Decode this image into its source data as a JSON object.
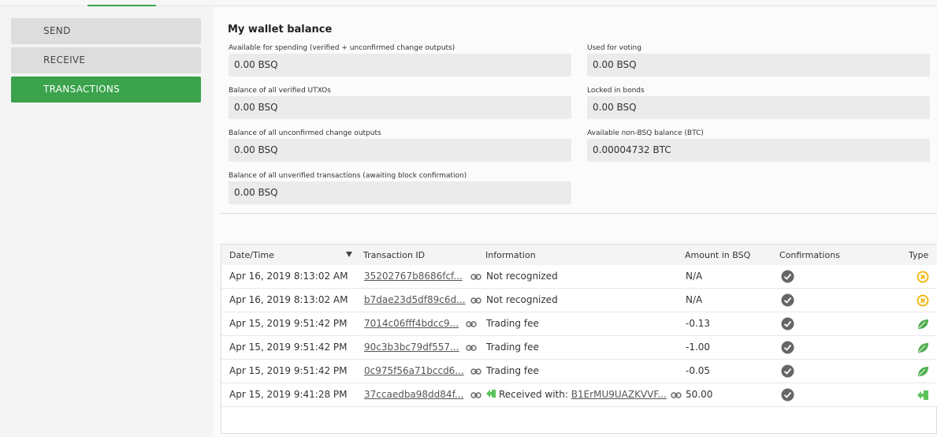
{
  "nav": {
    "send_label": "SEND",
    "receive_label": "RECEIVE",
    "transactions_label": "TRANSACTIONS"
  },
  "balance": {
    "title": "My wallet balance",
    "available_label": "Available for spending (verified + unconfirmed change outputs)",
    "available_value": "0.00 BSQ",
    "verified_label": "Balance of all verified UTXOs",
    "verified_value": "0.00 BSQ",
    "unconfirmed_change_label": "Balance of all unconfirmed change outputs",
    "unconfirmed_change_value": "0.00 BSQ",
    "unverified_label": "Balance of all unverified transactions (awaiting block confirmation)",
    "unverified_value": "0.00 BSQ",
    "voting_label": "Used for voting",
    "voting_value": "0.00 BSQ",
    "bonds_label": "Locked in bonds",
    "bonds_value": "0.00 BSQ",
    "nonbsq_label": "Available non-BSQ balance (BTC)",
    "nonbsq_value": "0.00004732 BTC"
  },
  "table": {
    "headers": {
      "date": "Date/Time",
      "txid": "Transaction ID",
      "info": "Information",
      "amount": "Amount in BSQ",
      "confirmations": "Confirmations",
      "type": "Type"
    },
    "rows": [
      {
        "date": "Apr 16, 2019 8:13:02 AM",
        "txid": "35202767b8686fcf...",
        "info": "Not recognized",
        "amount": "N/A",
        "type_icon": "unknown-icon"
      },
      {
        "date": "Apr 16, 2019 8:13:02 AM",
        "txid": "b7dae23d5df89c6d...",
        "info": "Not recognized",
        "amount": "N/A",
        "type_icon": "unknown-icon"
      },
      {
        "date": "Apr 15, 2019 9:51:42 PM",
        "txid": "7014c06fff4bdcc9...",
        "info": "Trading fee",
        "amount": "-0.13",
        "type_icon": "leaf-icon"
      },
      {
        "date": "Apr 15, 2019 9:51:42 PM",
        "txid": "90c3b3bc79df557...",
        "info": "Trading fee",
        "amount": "-1.00",
        "type_icon": "leaf-icon"
      },
      {
        "date": "Apr 15, 2019 9:51:42 PM",
        "txid": "0c975f56a71bccd6...",
        "info": "Trading fee",
        "amount": "-0.05",
        "type_icon": "leaf-icon"
      },
      {
        "date": "Apr 15, 2019 9:41:28 PM",
        "txid": "37ccaedba98dd84f...",
        "info_prefix": "Received with: ",
        "info_address": "B1ErMU9UAZKVVF...",
        "amount": "50.00",
        "type_icon": "received-icon"
      }
    ]
  },
  "colors": {
    "accent": "#3aa34c",
    "unknown": "#f0b400",
    "leaf": "#4cae4c",
    "received": "#5cc35c"
  }
}
